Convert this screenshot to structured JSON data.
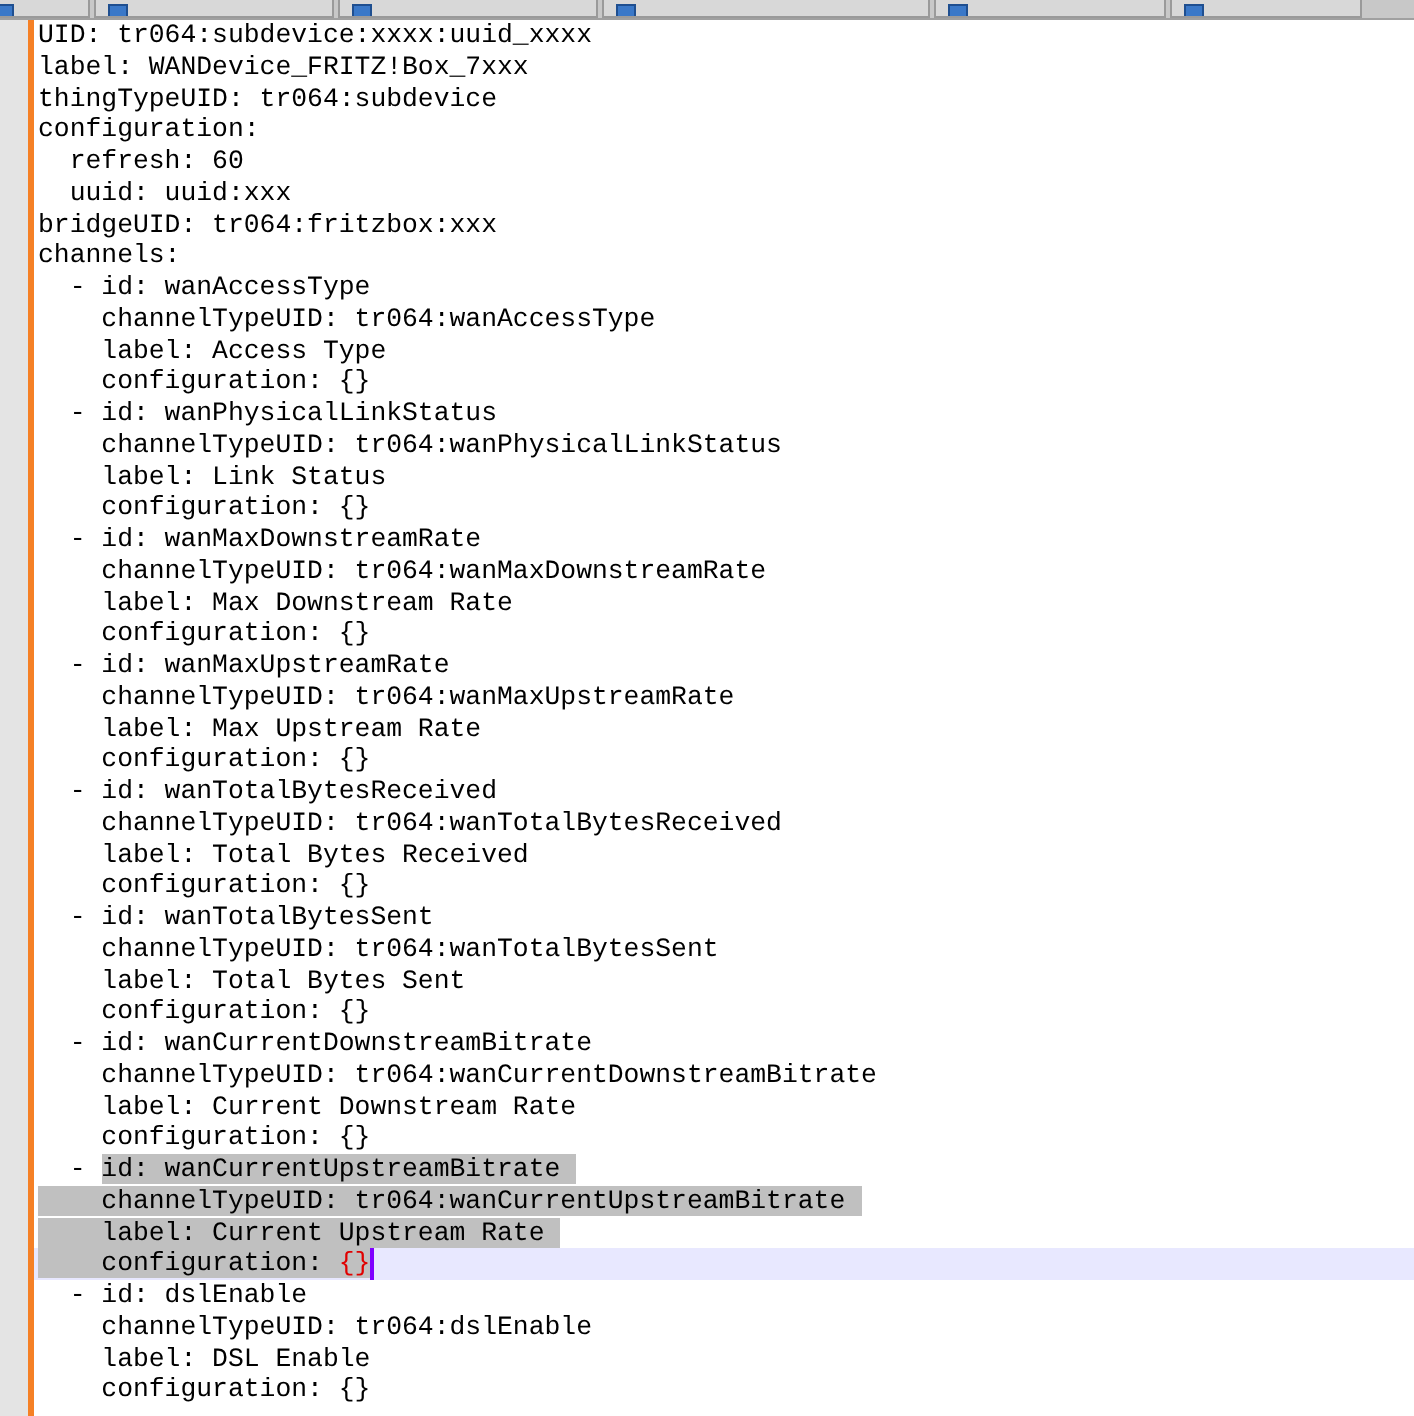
{
  "tabs": [
    {
      "selected": false
    },
    {
      "selected": false
    },
    {
      "selected": false
    },
    {
      "selected": false
    },
    {
      "selected": false
    },
    {
      "selected": false
    }
  ],
  "editor": {
    "lines": [
      {
        "current": false,
        "segments": [
          {
            "kind": "plain",
            "selected": false,
            "text": "UID: tr064:subdevice:xxxx:uuid_xxxx"
          }
        ]
      },
      {
        "current": false,
        "segments": [
          {
            "kind": "plain",
            "selected": false,
            "text": "label: WANDevice_FRITZ!Box_7xxx"
          }
        ]
      },
      {
        "current": false,
        "segments": [
          {
            "kind": "plain",
            "selected": false,
            "text": "thingTypeUID: tr064:subdevice"
          }
        ]
      },
      {
        "current": false,
        "segments": [
          {
            "kind": "plain",
            "selected": false,
            "text": "configuration:"
          }
        ]
      },
      {
        "current": false,
        "segments": [
          {
            "kind": "plain",
            "selected": false,
            "text": "  refresh: 60"
          }
        ]
      },
      {
        "current": false,
        "segments": [
          {
            "kind": "plain",
            "selected": false,
            "text": "  uuid: uuid:xxx"
          }
        ]
      },
      {
        "current": false,
        "segments": [
          {
            "kind": "plain",
            "selected": false,
            "text": "bridgeUID: tr064:fritzbox:xxx"
          }
        ]
      },
      {
        "current": false,
        "segments": [
          {
            "kind": "plain",
            "selected": false,
            "text": "channels:"
          }
        ]
      },
      {
        "current": false,
        "segments": [
          {
            "kind": "plain",
            "selected": false,
            "text": "  - id: wanAccessType"
          }
        ]
      },
      {
        "current": false,
        "segments": [
          {
            "kind": "plain",
            "selected": false,
            "text": "    channelTypeUID: tr064:wanAccessType"
          }
        ]
      },
      {
        "current": false,
        "segments": [
          {
            "kind": "plain",
            "selected": false,
            "text": "    label: Access Type"
          }
        ]
      },
      {
        "current": false,
        "segments": [
          {
            "kind": "plain",
            "selected": false,
            "text": "    configuration: {}"
          }
        ]
      },
      {
        "current": false,
        "segments": [
          {
            "kind": "plain",
            "selected": false,
            "text": "  - id: wanPhysicalLinkStatus"
          }
        ]
      },
      {
        "current": false,
        "segments": [
          {
            "kind": "plain",
            "selected": false,
            "text": "    channelTypeUID: tr064:wanPhysicalLinkStatus"
          }
        ]
      },
      {
        "current": false,
        "segments": [
          {
            "kind": "plain",
            "selected": false,
            "text": "    label: Link Status"
          }
        ]
      },
      {
        "current": false,
        "segments": [
          {
            "kind": "plain",
            "selected": false,
            "text": "    configuration: {}"
          }
        ]
      },
      {
        "current": false,
        "segments": [
          {
            "kind": "plain",
            "selected": false,
            "text": "  - id: wanMaxDownstreamRate"
          }
        ]
      },
      {
        "current": false,
        "segments": [
          {
            "kind": "plain",
            "selected": false,
            "text": "    channelTypeUID: tr064:wanMaxDownstreamRate"
          }
        ]
      },
      {
        "current": false,
        "segments": [
          {
            "kind": "plain",
            "selected": false,
            "text": "    label: Max Downstream Rate"
          }
        ]
      },
      {
        "current": false,
        "segments": [
          {
            "kind": "plain",
            "selected": false,
            "text": "    configuration: {}"
          }
        ]
      },
      {
        "current": false,
        "segments": [
          {
            "kind": "plain",
            "selected": false,
            "text": "  - id: wanMaxUpstreamRate"
          }
        ]
      },
      {
        "current": false,
        "segments": [
          {
            "kind": "plain",
            "selected": false,
            "text": "    channelTypeUID: tr064:wanMaxUpstreamRate"
          }
        ]
      },
      {
        "current": false,
        "segments": [
          {
            "kind": "plain",
            "selected": false,
            "text": "    label: Max Upstream Rate"
          }
        ]
      },
      {
        "current": false,
        "segments": [
          {
            "kind": "plain",
            "selected": false,
            "text": "    configuration: {}"
          }
        ]
      },
      {
        "current": false,
        "segments": [
          {
            "kind": "plain",
            "selected": false,
            "text": "  - id: wanTotalBytesReceived"
          }
        ]
      },
      {
        "current": false,
        "segments": [
          {
            "kind": "plain",
            "selected": false,
            "text": "    channelTypeUID: tr064:wanTotalBytesReceived"
          }
        ]
      },
      {
        "current": false,
        "segments": [
          {
            "kind": "plain",
            "selected": false,
            "text": "    label: Total Bytes Received"
          }
        ]
      },
      {
        "current": false,
        "segments": [
          {
            "kind": "plain",
            "selected": false,
            "text": "    configuration: {}"
          }
        ]
      },
      {
        "current": false,
        "segments": [
          {
            "kind": "plain",
            "selected": false,
            "text": "  - id: wanTotalBytesSent"
          }
        ]
      },
      {
        "current": false,
        "segments": [
          {
            "kind": "plain",
            "selected": false,
            "text": "    channelTypeUID: tr064:wanTotalBytesSent"
          }
        ]
      },
      {
        "current": false,
        "segments": [
          {
            "kind": "plain",
            "selected": false,
            "text": "    label: Total Bytes Sent"
          }
        ]
      },
      {
        "current": false,
        "segments": [
          {
            "kind": "plain",
            "selected": false,
            "text": "    configuration: {}"
          }
        ]
      },
      {
        "current": false,
        "segments": [
          {
            "kind": "plain",
            "selected": false,
            "text": "  - id: wanCurrentDownstreamBitrate"
          }
        ]
      },
      {
        "current": false,
        "segments": [
          {
            "kind": "plain",
            "selected": false,
            "text": "    channelTypeUID: tr064:wanCurrentDownstreamBitrate"
          }
        ]
      },
      {
        "current": false,
        "segments": [
          {
            "kind": "plain",
            "selected": false,
            "text": "    label: Current Downstream Rate"
          }
        ]
      },
      {
        "current": false,
        "segments": [
          {
            "kind": "plain",
            "selected": false,
            "text": "    configuration: {}"
          }
        ]
      },
      {
        "current": false,
        "segments": [
          {
            "kind": "plain",
            "selected": false,
            "text": "  - "
          },
          {
            "kind": "plain",
            "selected": true,
            "text": "id: wanCurrentUpstreamBitrate"
          }
        ]
      },
      {
        "current": false,
        "segments": [
          {
            "kind": "plain",
            "selected": true,
            "text": "    channelTypeUID: tr064:wanCurrentUpstreamBitrate"
          }
        ]
      },
      {
        "current": false,
        "segments": [
          {
            "kind": "plain",
            "selected": true,
            "text": "    label: Current Upstream Rate"
          }
        ]
      },
      {
        "current": true,
        "segments": [
          {
            "kind": "plain",
            "selected": true,
            "text": "    configuration: "
          },
          {
            "kind": "brace",
            "selected": true,
            "text": "{}"
          }
        ]
      },
      {
        "current": false,
        "segments": [
          {
            "kind": "plain",
            "selected": false,
            "text": "  - id: dslEnable"
          }
        ]
      },
      {
        "current": false,
        "segments": [
          {
            "kind": "plain",
            "selected": false,
            "text": "    channelTypeUID: tr064:dslEnable"
          }
        ]
      },
      {
        "current": false,
        "segments": [
          {
            "kind": "plain",
            "selected": false,
            "text": "    label: DSL Enable"
          }
        ]
      },
      {
        "current": false,
        "segments": [
          {
            "kind": "plain",
            "selected": false,
            "text": "    configuration: {}"
          }
        ]
      }
    ]
  }
}
